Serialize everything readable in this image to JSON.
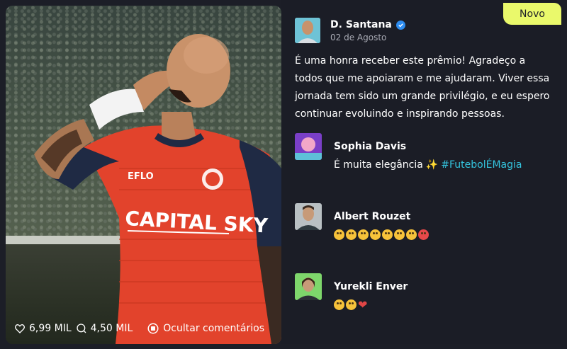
{
  "badge": {
    "label": "Novo",
    "color": "#eaf96b"
  },
  "photo": {
    "jersey_sponsor": "CAPITAL SKY",
    "kit_brand": "EFLO",
    "likes": "6,99 MIL",
    "comments": "4,50 MIL",
    "hide_comments_label": "Ocultar comentários"
  },
  "post": {
    "author": {
      "name": "D. Santana",
      "date": "02 de Agosto",
      "verified": true
    },
    "text": "É uma honra receber este prêmio! Agradeço a todos que me apoiaram e me ajudaram. Viver essa jornada tem sido um grande privilégio, e eu espero continuar evoluindo e inspirando pessoas."
  },
  "comments": [
    {
      "name": "Sophia Davis",
      "text": "É muita elegância",
      "hashtag": "#FutebolÉMagia"
    },
    {
      "name": "Albert Rouzet",
      "emoji": [
        "neutral-face",
        "sad-face",
        "crying-face",
        "disappointed-face",
        "astonished-face",
        "screaming-face",
        "frowning-face",
        "angry-face"
      ]
    },
    {
      "name": "Yurekli Enver",
      "emoji": [
        "grinning-face",
        "beaming-face",
        "red-heart"
      ]
    }
  ],
  "colors": {
    "accent": "#34c4de",
    "verified": "#2d8cf0",
    "jersey": "#e2432c",
    "sleeve": "#1f2a44"
  }
}
